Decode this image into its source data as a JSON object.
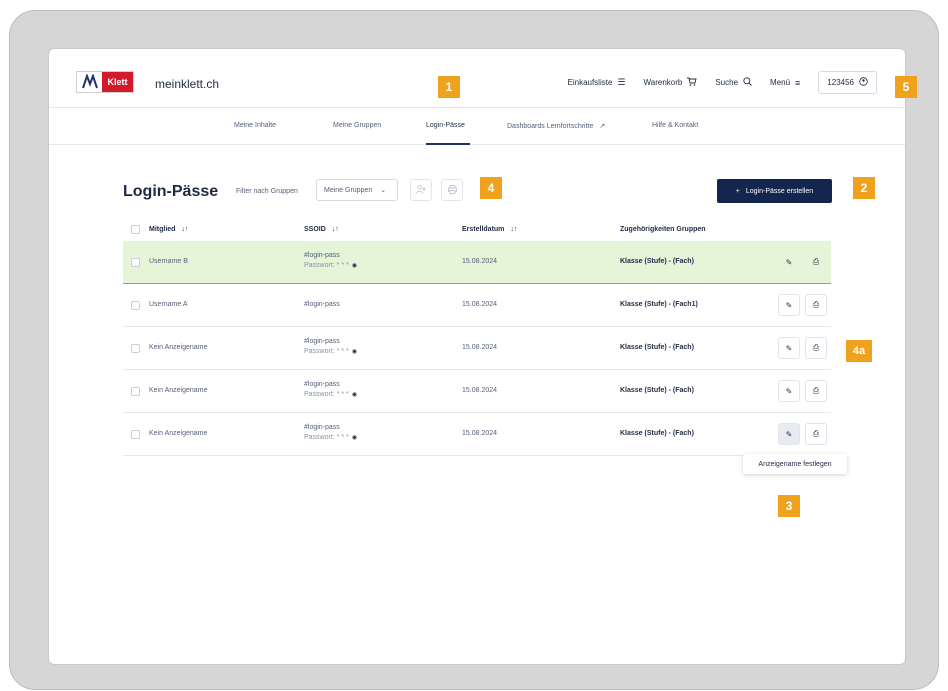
{
  "header": {
    "logo_text": "Klett",
    "site_name": "meinklett.ch",
    "nav": {
      "shopping_list": "Einkaufsliste",
      "cart": "Warenkorb",
      "search": "Suche",
      "menu": "Menü",
      "account": "123456"
    }
  },
  "subnav": {
    "tabs": [
      "Meine Inhalte",
      "Meine Gruppen",
      "Login-Pässe",
      "Dashboards Lernfortschritte",
      "Hilfe & Kontakt"
    ],
    "active": "Login-Pässe"
  },
  "page": {
    "title": "Login-Pässe",
    "filter_label": "Filter nach Gruppen",
    "filter_value": "Meine Gruppen",
    "create_button": "Login-Pässe erstellen"
  },
  "table": {
    "columns": [
      "Mitglied",
      "SSOID",
      "Erstelldatum",
      "Zugehörigkeiten Gruppen"
    ],
    "rows": [
      {
        "member": "Username B",
        "ssoid": "#login-pass",
        "password": "Passwort: * * *",
        "date": "15.08.2024",
        "groups": "Klasse (Stufe) - (Fach)",
        "highlighted": true
      },
      {
        "member": "Username A",
        "ssoid": "#login-pass",
        "password": "",
        "date": "15.08.2024",
        "groups": "Klasse (Stufe) - (Fach1)",
        "highlighted": false
      },
      {
        "member": "Kein Anzeigename",
        "ssoid": "#login-pass",
        "password": "Passwort: * * *",
        "date": "15.08.2024",
        "groups": "Klasse (Stufe) - (Fach)",
        "highlighted": false
      },
      {
        "member": "Kein Anzeigename",
        "ssoid": "#login-pass",
        "password": "Passwort: * * *",
        "date": "15.08.2024",
        "groups": "Klasse (Stufe) - (Fach)",
        "highlighted": false
      },
      {
        "member": "Kein Anzeigename",
        "ssoid": "#login-pass",
        "password": "Passwort: * * *",
        "date": "15.08.2024",
        "groups": "Klasse (Stufe) - (Fach)",
        "highlighted": false
      }
    ]
  },
  "tooltip": "Anzeigename festlegen",
  "markers": {
    "m1": "1",
    "m2": "2",
    "m3": "3",
    "m4": "4",
    "m4a": "4a",
    "m5": "5"
  },
  "colors": {
    "accent": "#14264d",
    "marker": "#f0a21e",
    "highlight_row": "#e6f4d8",
    "brand_red": "#d21a2b"
  },
  "icons": [
    "list-icon",
    "cart-icon",
    "search-icon",
    "menu-icon",
    "user-circle-icon",
    "chevron-down-icon",
    "add-user-icon",
    "print-icon",
    "plus-icon",
    "sort-icon",
    "eye-icon",
    "edit-icon",
    "external-link-icon"
  ]
}
